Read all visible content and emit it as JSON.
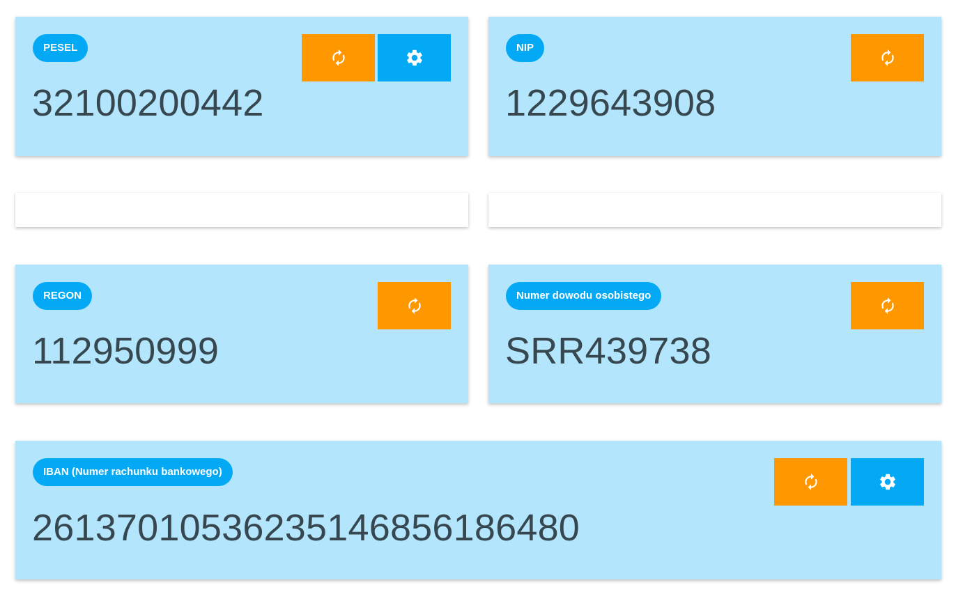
{
  "cards": {
    "pesel": {
      "badge": "PESEL",
      "value": "32100200442"
    },
    "nip": {
      "badge": "NIP",
      "value": "1229643908"
    },
    "regon": {
      "badge": "REGON",
      "value": "112950999"
    },
    "id_card": {
      "badge": "Numer dowodu osobistego",
      "value": "SRR439738"
    },
    "iban": {
      "badge": "IBAN (Numer rachunku bankowego)",
      "value": "26137010536235146856186480"
    }
  },
  "icons": {
    "refresh": "refresh-icon",
    "settings": "gear-icon"
  },
  "colors": {
    "card_background": "#b3e5fc",
    "badge_background": "#03a9f4",
    "refresh_button": "#ff9800",
    "settings_button": "#03a9f4",
    "value_text": "#37474f"
  }
}
